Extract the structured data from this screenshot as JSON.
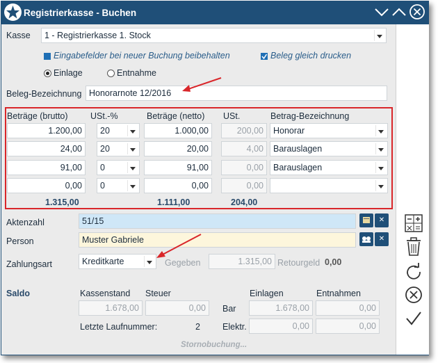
{
  "window": {
    "title": "Registrierkasse - Buchen"
  },
  "kasse": {
    "label": "Kasse",
    "value": "1 - Registrierkasse 1. Stock"
  },
  "options": {
    "keep_fields": "Eingabefelder bei neuer Buchung beibehalten",
    "print_receipt": "Beleg gleich drucken",
    "einlage": "Einlage",
    "entnahme": "Entnahme"
  },
  "beleg": {
    "label": "Beleg-Bezeichnung",
    "value": "Honorarnote 12/2016"
  },
  "table": {
    "headers": [
      "Beträge (brutto)",
      "USt.-%",
      "Beträge (netto)",
      "USt.",
      "Betrag-Bezeichnung"
    ],
    "rows": [
      {
        "brutto": "1.200,00",
        "ust_pct": "20",
        "netto": "1.000,00",
        "ust": "200,00",
        "bez": "Honorar"
      },
      {
        "brutto": "24,00",
        "ust_pct": "20",
        "netto": "20,00",
        "ust": "4,00",
        "bez": "Barauslagen"
      },
      {
        "brutto": "91,00",
        "ust_pct": "0",
        "netto": "91,00",
        "ust": "0,00",
        "bez": "Barauslagen"
      },
      {
        "brutto": "0,00",
        "ust_pct": "0",
        "netto": "0,00",
        "ust": "0,00",
        "bez": ""
      }
    ],
    "totals": {
      "brutto": "1.315,00",
      "netto": "1.111,00",
      "ust": "204,00"
    }
  },
  "akten": {
    "label": "Aktenzahl",
    "value": "51/15"
  },
  "person": {
    "label": "Person",
    "value": "Muster Gabriele"
  },
  "zahlung": {
    "label": "Zahlungsart",
    "value": "Kreditkarte",
    "gegeben_label": "Gegeben",
    "gegeben_value": "1.315,00",
    "retour_label": "Retourgeld",
    "retour_value": "0,00"
  },
  "saldo": {
    "label": "Saldo",
    "kassenstand_label": "Kassenstand",
    "kassenstand": "1.678,00",
    "steuer_label": "Steuer",
    "steuer": "0,00",
    "einlagen_label": "Einlagen",
    "entnahmen_label": "Entnahmen",
    "bar_label": "Bar",
    "bar_einlagen": "1.678,00",
    "bar_entnahmen": "0,00",
    "elektr_label": "Elektr.",
    "elektr_einlagen": "0,00",
    "elektr_entnahmen": "0,00",
    "laufnummer_label": "Letzte Laufnummer:",
    "laufnummer": "2"
  },
  "storno": "Stornobuchung...",
  "icons": {
    "app": "star-icon",
    "collapse": "chevron-down-icon",
    "expand": "chevron-up-icon",
    "close": "close-circle-icon",
    "calculator": "calculator-icon",
    "trash": "trash-icon",
    "refresh": "refresh-icon",
    "cancel": "cancel-icon",
    "confirm": "checkmark-icon"
  },
  "colors": {
    "titlebar": "#1f4f78",
    "highlight": "#d9262a",
    "akten_bg": "#cfe7f7",
    "person_bg": "#fdf6dc"
  }
}
